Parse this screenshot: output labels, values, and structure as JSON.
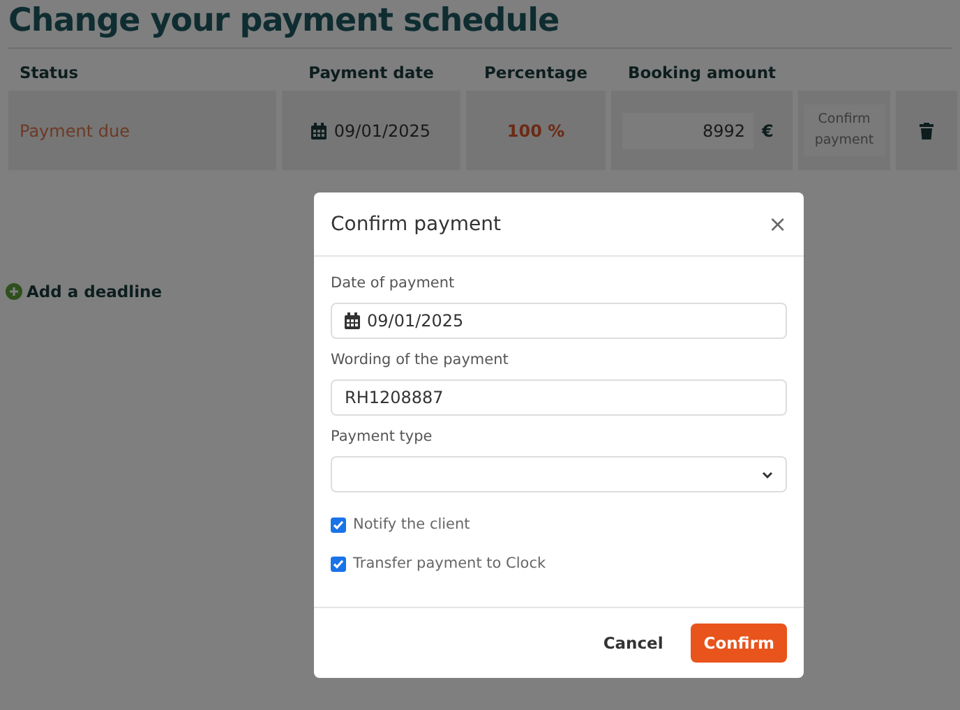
{
  "page": {
    "title": "Change your payment schedule"
  },
  "table": {
    "columns": [
      "Status",
      "Payment date",
      "Percentage",
      "Booking amount"
    ],
    "rows": [
      {
        "status": "Payment due",
        "payment_date": "09/01/2025",
        "percentage": "100 %",
        "amount": "8992",
        "currency": "€",
        "action": "Confirm payment"
      }
    ]
  },
  "add_deadline": "Add a deadline",
  "modal": {
    "title": "Confirm payment",
    "close": "×",
    "fields": [
      {
        "kind": "date",
        "label": "Date of payment",
        "value": "09/01/2025"
      },
      {
        "kind": "text",
        "label": "Wording of the payment",
        "value": "RH1208887"
      },
      {
        "kind": "select",
        "label": "Payment type"
      }
    ],
    "checkboxes": [
      {
        "label": "Notify the client",
        "checked": true
      },
      {
        "label": "Transfer payment to Clock",
        "checked": true
      }
    ],
    "buttons": [
      "Cancel",
      "Confirm"
    ]
  }
}
